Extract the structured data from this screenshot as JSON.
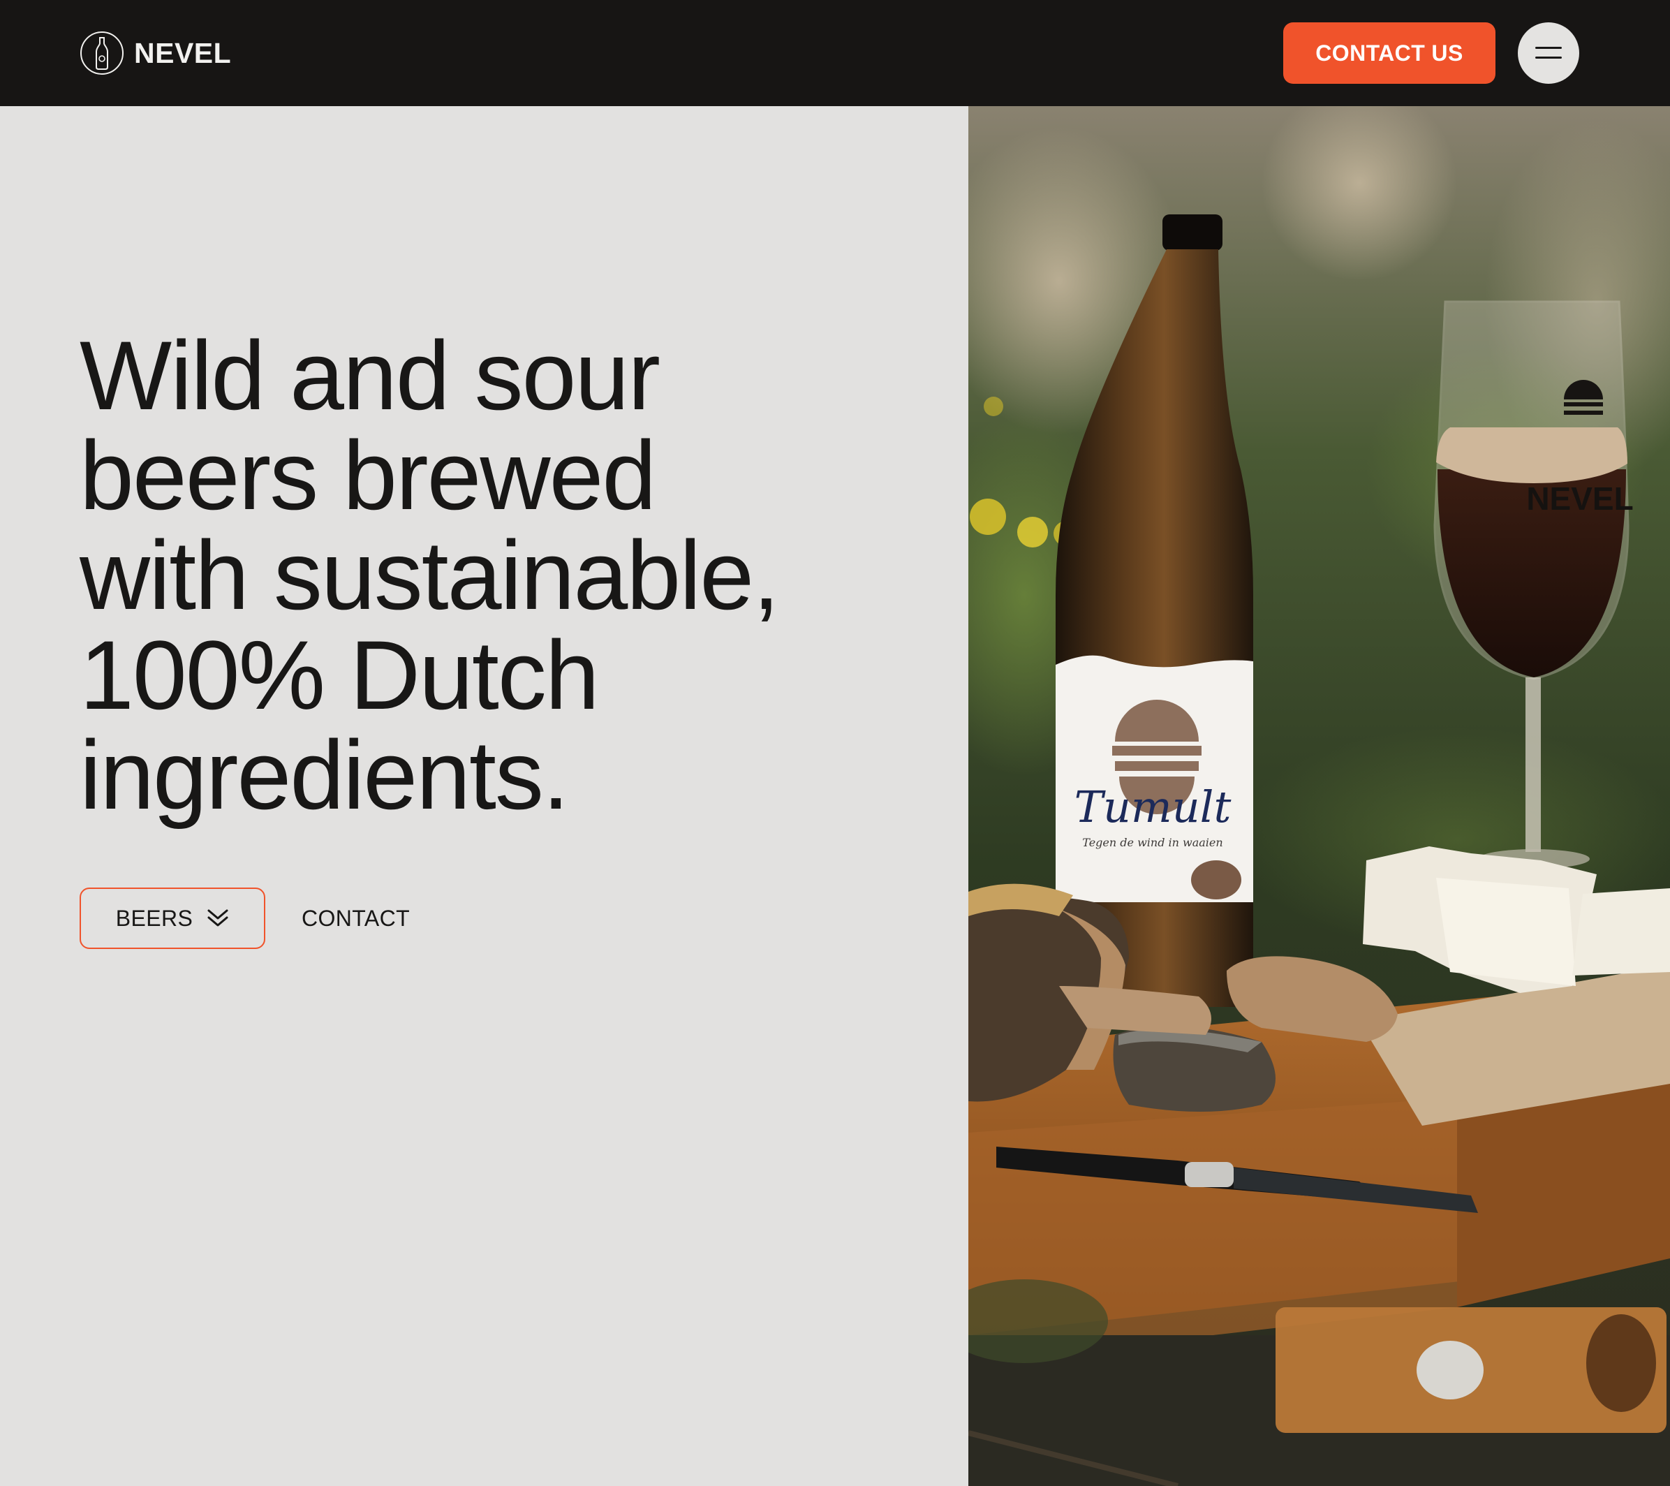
{
  "header": {
    "brand": "NEVEL",
    "logo_icon": "bottle-logo-icon",
    "contact_button": "CONTACT US",
    "menu_icon": "hamburger-menu-icon"
  },
  "hero": {
    "title_lines": [
      "Wild and sour",
      "beers brewed",
      "with sustainable,",
      "100% Dutch",
      "ingredients."
    ],
    "beers_button": "BEERS",
    "beers_icon": "double-chevron-down-icon",
    "contact_link": "CONTACT"
  },
  "photo": {
    "label_brand": "Tumult",
    "label_tagline": "Tegen de wind in waaien",
    "glass_brand": "NEVEL"
  },
  "colors": {
    "accent": "#f0532b",
    "header_bg": "#171514",
    "page_bg": "#e2e1e0",
    "text": "#181716"
  }
}
